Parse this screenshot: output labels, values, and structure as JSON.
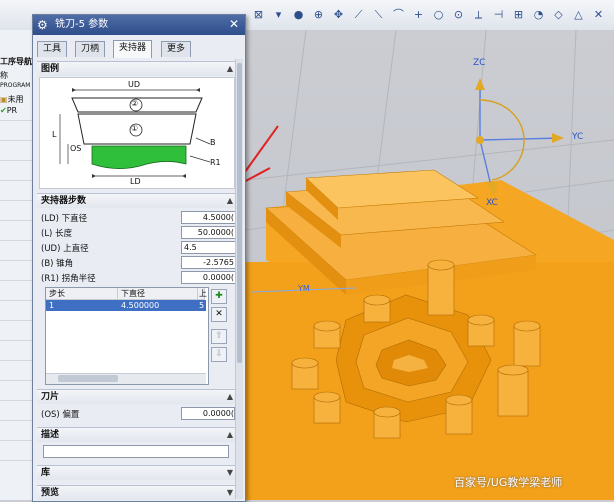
{
  "toolbar": {
    "icons": [
      "select-icon",
      "move-icon",
      "zoom-icon",
      "line-icon",
      "arc-icon",
      "point-icon",
      "snap-icon",
      "circle-icon",
      "plus-icon",
      "grid-icon",
      "tangent-icon",
      "snap-end-icon"
    ]
  },
  "navigator": {
    "title": "工序导航器",
    "col": "称",
    "root": "PROGRAM",
    "unused": "未用",
    "item": "PR"
  },
  "dialog": {
    "title": "铣刀-5 参数",
    "tabs": [
      "工具",
      "刀柄",
      "夹持器",
      "更多"
    ],
    "active_tab": "夹持器"
  },
  "sections": {
    "legend": "图例",
    "holder_steps": "夹持器步数",
    "insert": "刀片",
    "description": "描述",
    "library": "库",
    "preview": "预览"
  },
  "diagram": {
    "labels": {
      "ud": "UD",
      "ld": "LD",
      "os": "OS",
      "l": "L",
      "b": "B",
      "r1": "R1",
      "c1": "①",
      "c2": "②"
    }
  },
  "params": [
    {
      "key": "(LD) 下直径",
      "value": "4.5000("
    },
    {
      "key": "(L) 长度",
      "value": "50.0000("
    },
    {
      "key": "(UD) 上直径",
      "value": "4.5"
    },
    {
      "key": "(B) 锥角",
      "value": "-2.5765"
    },
    {
      "key": "(R1) 拐角半径",
      "value": "0.0000("
    }
  ],
  "step_table": {
    "headers": [
      "步长",
      "下直径",
      "上"
    ],
    "rows": [
      [
        "1",
        "4.500000",
        "5"
      ]
    ]
  },
  "offset": {
    "key": "(OS) 偏置",
    "value": "0.0000("
  },
  "viewport": {
    "axes": {
      "zc": "ZC",
      "yc": "YC",
      "xc": "XC",
      "ym": "YM"
    },
    "watermark": "百家号/UG教学梁老师"
  }
}
